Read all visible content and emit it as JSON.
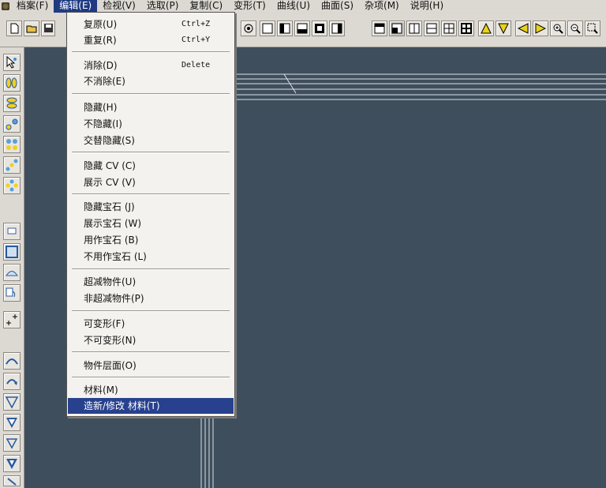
{
  "menubar": {
    "items": [
      {
        "label": "档案(F)"
      },
      {
        "label": "编辑(E)"
      },
      {
        "label": "检视(V)"
      },
      {
        "label": "选取(P)"
      },
      {
        "label": "复制(C)"
      },
      {
        "label": "变形(T)"
      },
      {
        "label": "曲线(U)"
      },
      {
        "label": "曲面(S)"
      },
      {
        "label": "杂项(M)"
      },
      {
        "label": "说明(H)"
      }
    ]
  },
  "edit_menu": {
    "items": [
      {
        "label": "复原(U)",
        "shortcut": "Ctrl+Z"
      },
      {
        "label": "重复(R)",
        "shortcut": "Ctrl+Y"
      },
      {
        "label": "消除(D)",
        "shortcut": "Delete"
      },
      {
        "label": "不消除(E)",
        "shortcut": ""
      },
      {
        "label": "隐藏(H)",
        "shortcut": ""
      },
      {
        "label": "不隐藏(I)",
        "shortcut": ""
      },
      {
        "label": "交替隐藏(S)",
        "shortcut": ""
      },
      {
        "label": "隐藏 CV (C)",
        "shortcut": ""
      },
      {
        "label": "展示 CV (V)",
        "shortcut": ""
      },
      {
        "label": "隐藏宝石 (J)",
        "shortcut": ""
      },
      {
        "label": "展示宝石 (W)",
        "shortcut": ""
      },
      {
        "label": "用作宝石 (B)",
        "shortcut": ""
      },
      {
        "label": "不用作宝石 (L)",
        "shortcut": ""
      },
      {
        "label": "超减物件(U)",
        "shortcut": ""
      },
      {
        "label": "非超减物件(P)",
        "shortcut": ""
      },
      {
        "label": "可变形(F)",
        "shortcut": ""
      },
      {
        "label": "不可变形(N)",
        "shortcut": ""
      },
      {
        "label": "物件层面(O)",
        "shortcut": ""
      },
      {
        "label": "材料(M)",
        "shortcut": ""
      },
      {
        "label": "造新/修改 材料(T)",
        "shortcut": ""
      }
    ]
  },
  "colors": {
    "viewport_bg": "#3f4e5c",
    "menu_highlight": "#27418e",
    "accent_triangle": "#e9d21a"
  }
}
